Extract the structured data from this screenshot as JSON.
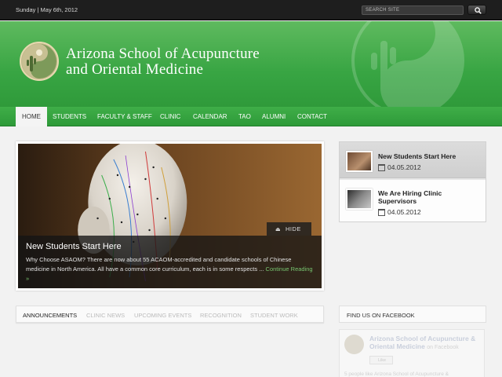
{
  "topbar": {
    "date": "Sunday | May 6th, 2012",
    "search_placeholder": "SEARCH SITE"
  },
  "header": {
    "title_line1": "Arizona School of Acupuncture",
    "title_line2": "and Oriental Medicine"
  },
  "nav": {
    "items": [
      {
        "label": "HOME"
      },
      {
        "label": "STUDENTS"
      },
      {
        "label": "FACULTY & STAFF"
      },
      {
        "label": "CLINIC"
      },
      {
        "label": "CALENDAR"
      },
      {
        "label": "TAO"
      },
      {
        "label": "ALUMNI"
      },
      {
        "label": "CONTACT"
      }
    ]
  },
  "slider": {
    "hide_label": "HIDE",
    "title": "New Students Start Here",
    "excerpt": "Why Choose ASAOM? There are now about 55 ACAOM-accredited and candidate schools of Chinese medicine in North America. All have a common core curriculum, each is in some respects ... ",
    "more_link": "Continue Reading »"
  },
  "news": {
    "items": [
      {
        "title": "New Students Start Here",
        "date": "04.05.2012"
      },
      {
        "title": "We Are Hiring Clinic Supervisors",
        "date": "04.05.2012"
      }
    ]
  },
  "tabs": {
    "items": [
      {
        "label": "ANNOUNCEMENTS"
      },
      {
        "label": "CLINIC NEWS"
      },
      {
        "label": "UPCOMING EVENTS"
      },
      {
        "label": "RECOGNITION"
      },
      {
        "label": "STUDENT WORK"
      }
    ]
  },
  "facebook": {
    "title": "FIND US ON FACEBOOK",
    "page_name": "Arizona School of Acupuncture & Oriental Medicine",
    "on_facebook": "on Facebook",
    "like_label": "Like",
    "count_text": "5 people like Arizona School of Acupuncture &"
  },
  "colors": {
    "brand_green": "#38a543",
    "topbar": "#1e1e1e",
    "link_green": "#77c46f"
  }
}
